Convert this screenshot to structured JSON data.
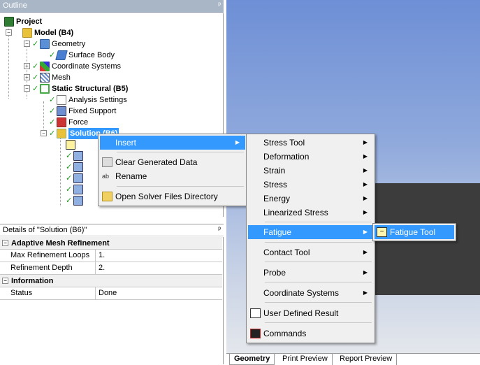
{
  "outline": {
    "title": "Outline",
    "pin": "ᵖ",
    "tree": [
      {
        "label": "Project",
        "bold": true
      },
      {
        "label": "Model (B4)",
        "bold": true
      },
      {
        "label": "Geometry",
        "bold": false
      },
      {
        "label": "Surface Body",
        "bold": false
      },
      {
        "label": "Coordinate Systems",
        "bold": false
      },
      {
        "label": "Mesh",
        "bold": false
      },
      {
        "label": "Static Structural (B5)",
        "bold": true
      },
      {
        "label": "Analysis Settings",
        "bold": false
      },
      {
        "label": "Fixed Support",
        "bold": false
      },
      {
        "label": "Force",
        "bold": false
      },
      {
        "label": "Solution (B6)",
        "bold": true
      }
    ]
  },
  "details": {
    "title": "Details of \"Solution (B6)\"",
    "pin": "ᵖ",
    "sections": [
      {
        "name": "Adaptive Mesh Refinement",
        "rows": [
          {
            "key": "Max Refinement Loops",
            "value": "1."
          },
          {
            "key": "Refinement Depth",
            "value": "2."
          }
        ]
      },
      {
        "name": "Information",
        "rows": [
          {
            "key": "Status",
            "value": "Done"
          }
        ]
      }
    ]
  },
  "context_menu": {
    "items": [
      {
        "label": "Insert",
        "icon": "none",
        "submenu": true
      },
      {
        "label": "Clear Generated Data",
        "icon": "eraser-icon"
      },
      {
        "label": "Rename",
        "icon": "rename-icon"
      },
      {
        "label": "Open Solver Files Directory",
        "icon": "folder-icon"
      }
    ]
  },
  "insert_menu": {
    "items": [
      {
        "label": "Stress Tool",
        "submenu": true
      },
      {
        "label": "Deformation",
        "submenu": true
      },
      {
        "label": "Strain",
        "submenu": true
      },
      {
        "label": "Stress",
        "submenu": true
      },
      {
        "label": "Energy",
        "submenu": true
      },
      {
        "label": "Linearized Stress",
        "submenu": true
      },
      {
        "label": "Fatigue",
        "submenu": true
      },
      {
        "label": "Contact Tool",
        "submenu": true
      },
      {
        "label": "Probe",
        "submenu": true
      },
      {
        "label": "Coordinate Systems",
        "submenu": true
      },
      {
        "label": "User Defined Result",
        "icon": "user-defined-result-icon"
      },
      {
        "label": "Commands",
        "icon": "commands-icon"
      }
    ]
  },
  "fatigue_menu": {
    "items": [
      {
        "label": "Fatigue Tool",
        "icon": "fatigue-tool-icon"
      }
    ]
  },
  "tabs": [
    "Geometry",
    "Print Preview",
    "Report Preview"
  ],
  "colors": {
    "selection": "#3399ff",
    "panel_title": "#a9b6c6",
    "check": "#1a9a1a"
  }
}
